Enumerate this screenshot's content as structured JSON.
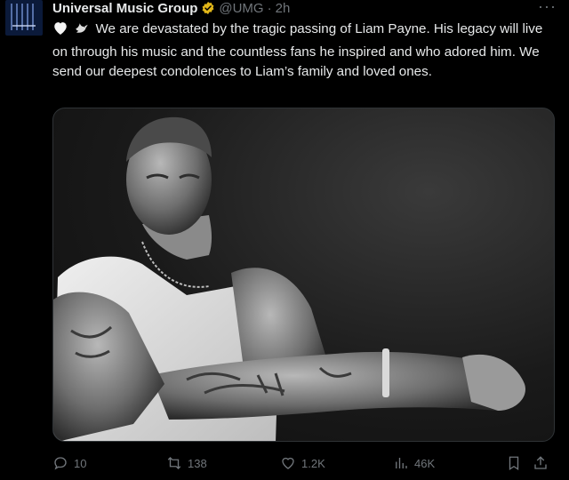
{
  "tweet": {
    "author_name": "Universal Music Group",
    "handle": "@UMG",
    "separator": "·",
    "time": "2h",
    "more_label": "···",
    "text": "We are devastated by the tragic passing of Liam Payne. His legacy will live on through his music and the countless fans he inspired and who adored him. We send our deepest condolences to Liam’s family and loved ones.",
    "emojis": [
      "white-heart-emoji",
      "dove-emoji"
    ]
  },
  "media": {
    "alt": "Black and white photo of Liam Payne in a white tank top"
  },
  "actions": {
    "replies": "10",
    "reposts": "138",
    "likes": "1.2K",
    "views": "46K"
  },
  "colors": {
    "background": "#000000",
    "text": "#e7e9ea",
    "muted": "#71767b",
    "verified": "#e2b719"
  }
}
